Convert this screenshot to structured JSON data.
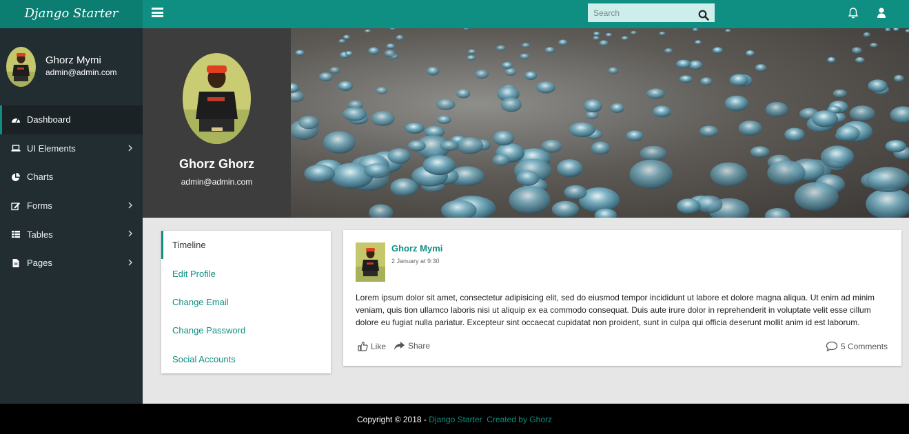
{
  "brand": {
    "title": "Django Starter"
  },
  "header": {
    "search_placeholder": "Search",
    "icons": [
      "menu-icon",
      "search-icon",
      "bell-icon",
      "user-icon"
    ]
  },
  "sidebar": {
    "user_name": "Ghorz Mymi",
    "user_email": "admin@admin.com",
    "items": [
      {
        "label": "Dashboard",
        "icon": "dashboard-icon",
        "active": true,
        "has_submenu": false
      },
      {
        "label": "UI Elements",
        "icon": "laptop-icon",
        "active": false,
        "has_submenu": true
      },
      {
        "label": "Charts",
        "icon": "pie-chart-icon",
        "active": false,
        "has_submenu": false
      },
      {
        "label": "Forms",
        "icon": "edit-icon",
        "active": false,
        "has_submenu": true
      },
      {
        "label": "Tables",
        "icon": "table-icon",
        "active": false,
        "has_submenu": true
      },
      {
        "label": "Pages",
        "icon": "file-icon",
        "active": false,
        "has_submenu": true
      }
    ]
  },
  "profile": {
    "name": "Ghorz Ghorz",
    "email": "admin@admin.com"
  },
  "profile_menu": {
    "items": [
      {
        "label": "Timeline",
        "active": true
      },
      {
        "label": "Edit Profile",
        "active": false
      },
      {
        "label": "Change Email",
        "active": false
      },
      {
        "label": "Change Password",
        "active": false
      },
      {
        "label": "Social Accounts",
        "active": false
      }
    ]
  },
  "post": {
    "author": "Ghorz Mymi",
    "time": "2 January at 9:30",
    "body": "Lorem ipsum dolor sit amet, consectetur adipisicing elit, sed do eiusmod tempor incididunt ut labore et dolore magna aliqua. Ut enim ad minim veniam, quis tion ullamco laboris nisi ut aliquip ex ea commodo consequat. Duis aute irure dolor in reprehenderit in voluptate velit esse cillum dolore eu fugiat nulla pariatur. Excepteur sint occaecat cupidatat non proident, sunt in culpa qui officia deserunt mollit anim id est laborum.",
    "like_label": "Like",
    "share_label": "Share",
    "comments_label": "5 Comments"
  },
  "footer": {
    "copyright": "Copyright © 2018 - ",
    "brand_link": "Django Starter",
    "credit_link": "Created by Ghorz"
  },
  "colors": {
    "accent": "#0e8f81",
    "sidebar": "#222d32",
    "profile_panel": "#3d3d3d"
  }
}
